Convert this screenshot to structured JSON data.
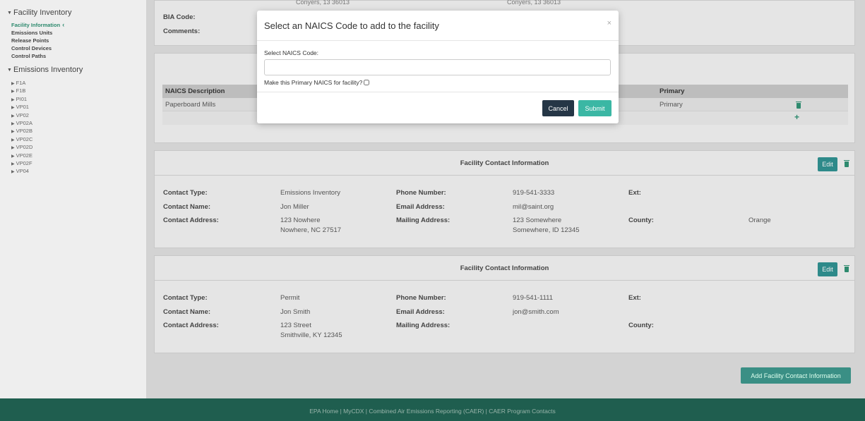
{
  "sidebar": {
    "facility_inventory": "Facility Inventory",
    "facility_items": [
      {
        "label": "Facility Information",
        "active": true
      },
      {
        "label": "Emissions Units",
        "active": false
      },
      {
        "label": "Release Points",
        "active": false
      },
      {
        "label": "Control Devices",
        "active": false
      },
      {
        "label": "Control Paths",
        "active": false
      }
    ],
    "emissions_inventory": "Emissions Inventory",
    "emissions_items": [
      "F1A",
      "F1B",
      "PI01",
      "VP01",
      "VP02",
      "VP02A",
      "VP02B",
      "VP02C",
      "VP02D",
      "VP02E",
      "VP02F",
      "VP04"
    ]
  },
  "facility": {
    "top_left_ghost": "Conyers, 13 36013",
    "top_right_ghost": "Conyers, 13 36013",
    "bia_code_label": "BIA Code:",
    "comments_label": "Comments:"
  },
  "naics_table": {
    "headers": {
      "description": "NAICS Description",
      "primary": "Primary"
    },
    "rows": [
      {
        "description": "Paperboard Mills",
        "primary": "Primary"
      }
    ]
  },
  "contacts": [
    {
      "section_title": "Facility Contact Information",
      "edit_label": "Edit",
      "contact_type_label": "Contact Type:",
      "contact_type": "Emissions Inventory",
      "contact_name_label": "Contact Name:",
      "contact_name": "Jon Miller",
      "contact_address_label": "Contact Address:",
      "contact_address_1": "123 Nowhere",
      "contact_address_2": "Nowhere, NC 27517",
      "phone_label": "Phone Number:",
      "phone": "919-541-3333",
      "email_label": "Email Address:",
      "email": "mil@saint.org",
      "mailing_label": "Mailing Address:",
      "mailing_1": "123 Somewhere",
      "mailing_2": "Somewhere, ID 12345",
      "ext_label": "Ext:",
      "county_label": "County:",
      "county": "Orange"
    },
    {
      "section_title": "Facility Contact Information",
      "edit_label": "Edit",
      "contact_type_label": "Contact Type:",
      "contact_type": "Permit",
      "contact_name_label": "Contact Name:",
      "contact_name": "Jon Smith",
      "contact_address_label": "Contact Address:",
      "contact_address_1": "123 Street",
      "contact_address_2": "Smithville, KY 12345",
      "phone_label": "Phone Number:",
      "phone": "919-541-1111",
      "email_label": "Email Address:",
      "email": "jon@smith.com",
      "mailing_label": "Mailing Address:",
      "mailing_1": "",
      "mailing_2": "",
      "ext_label": "Ext:",
      "county_label": "County:",
      "county": ""
    }
  ],
  "add_contact_label": "Add Facility Contact Information",
  "footer": "EPA Home | MyCDX | Combined Air Emissions Reporting (CAER) | CAER Program Contacts",
  "modal": {
    "title": "Select an NAICS Code to add to the facility",
    "close_glyph": "×",
    "naics_label": "Select NAICS Code:",
    "naics_value": "",
    "primary_label": "Make this Primary NAICS for facility?",
    "cancel_label": "Cancel",
    "submit_label": "Submit"
  },
  "colors": {
    "accent": "#2e8a6e",
    "footer_bg": "#1f5e4f",
    "cancel_bg": "#253646",
    "submit_bg": "#3bb7a4"
  }
}
